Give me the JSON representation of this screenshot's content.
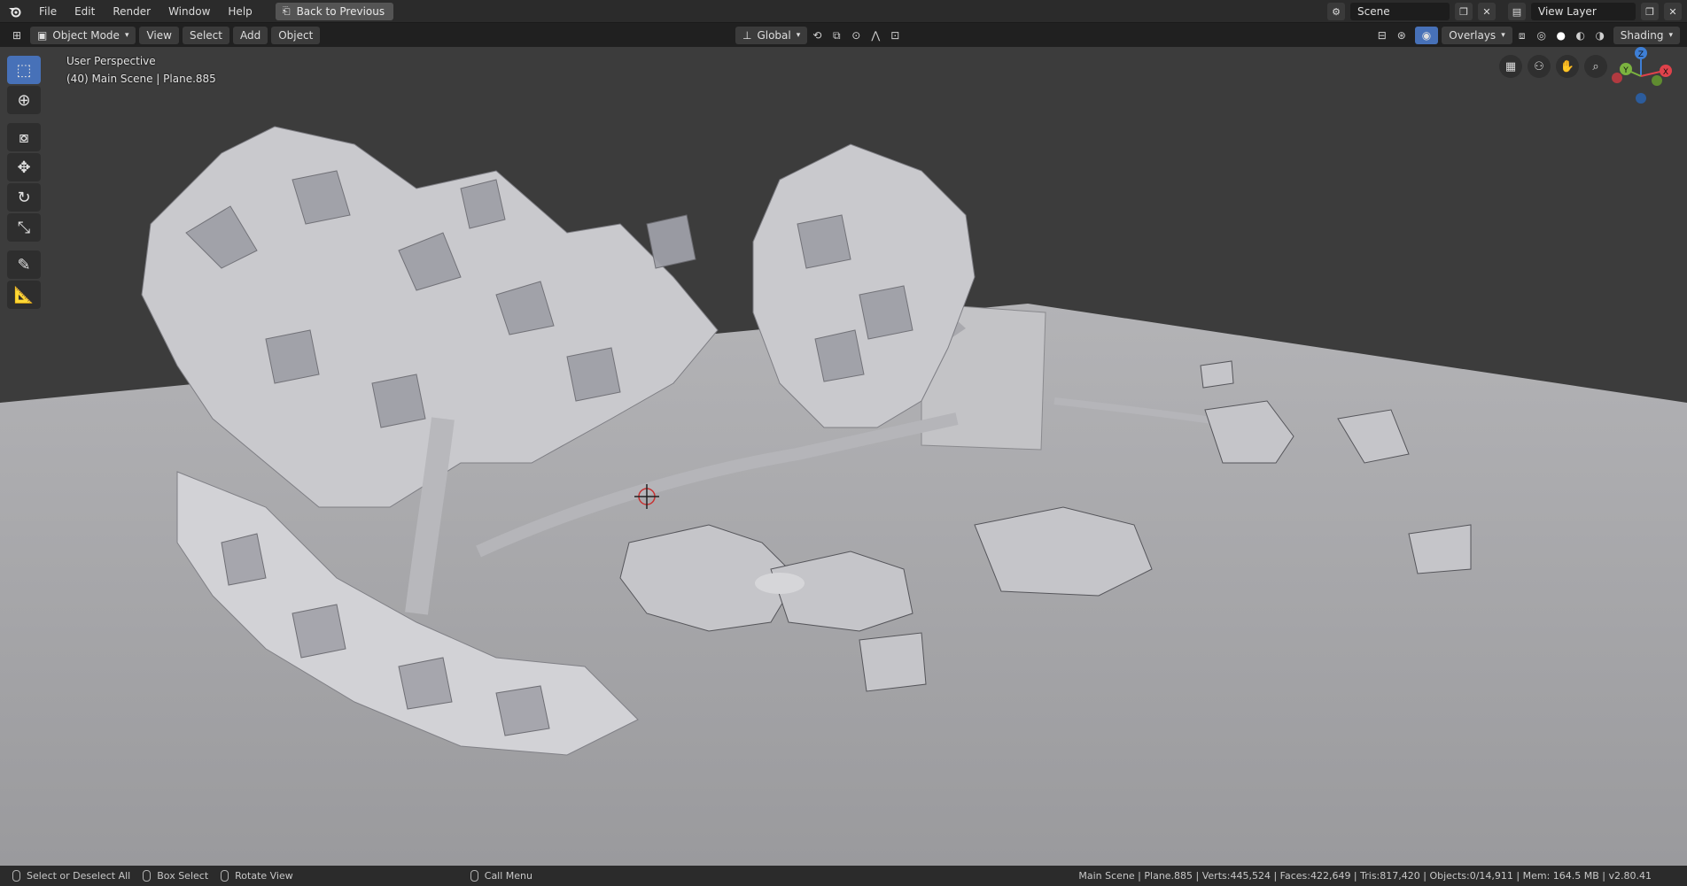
{
  "topbar": {
    "menus": [
      "File",
      "Edit",
      "Render",
      "Window",
      "Help"
    ],
    "back_button": "Back to Previous",
    "scene_name": "Scene",
    "view_layer": "View Layer"
  },
  "header": {
    "mode": "Object Mode",
    "menus": [
      "View",
      "Select",
      "Add",
      "Object"
    ],
    "transform_orientation": "Global",
    "overlays_label": "Overlays",
    "shading_label": "Shading"
  },
  "viewport": {
    "perspective_label": "User Perspective",
    "object_info": "(40) Main Scene | Plane.885",
    "gizmo_axes": {
      "x": "X",
      "y": "Y",
      "z": "Z"
    }
  },
  "toolbar": {
    "tools": [
      "select-box-icon",
      "cursor-icon",
      "transform-icon",
      "move-icon",
      "rotate-icon",
      "scale-icon",
      "annotate-icon",
      "measure-icon"
    ]
  },
  "statusbar": {
    "select_all": "Select or Deselect All",
    "box_select": "Box Select",
    "rotate_view": "Rotate View",
    "call_menu": "Call Menu",
    "stats": "Main Scene | Plane.885 | Verts:445,524 | Faces:422,649 | Tris:817,420 | Objects:0/14,911 | Mem: 164.5 MB | v2.80.41"
  },
  "colors": {
    "accent": "#4771b8",
    "background_top": "#3a3a3a",
    "ground": "#a3a3a6",
    "x_axis": "#e0424b",
    "y_axis": "#7bb33f",
    "z_axis": "#3e7fd6"
  }
}
